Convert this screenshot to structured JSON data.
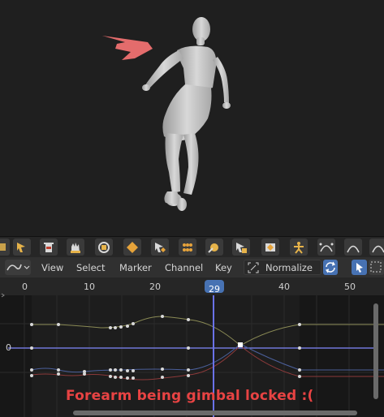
{
  "header": {
    "menus": [
      "View",
      "Select",
      "Marker",
      "Channel",
      "Key"
    ],
    "normalize_label": "Normalize"
  },
  "timeline": {
    "frame_ticks": [
      "0",
      "10",
      "20",
      "40",
      "50"
    ],
    "current_frame": "29",
    "value_tick": "0"
  },
  "annotation": {
    "caption": "Forearm being gimbal locked :(",
    "caption_color": "#e84343",
    "arrow_color": "#e46c6c"
  },
  "colors": {
    "playhead": "#6a72e8",
    "keyframe": "#d8d8d8",
    "curve_green": "#8a8a55",
    "curve_blue": "#4b5f9a",
    "curve_red": "#8c3a3a"
  }
}
